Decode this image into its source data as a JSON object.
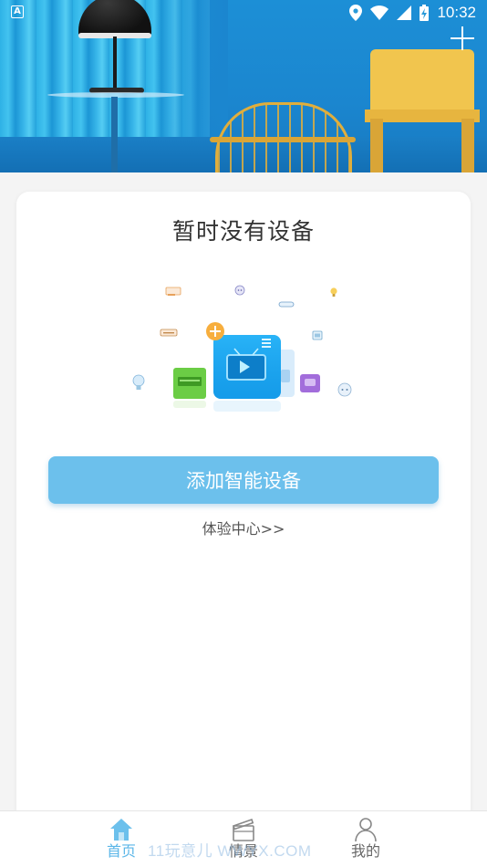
{
  "status_bar": {
    "app_indicator": "A",
    "time": "10:32",
    "icons": [
      "location-icon",
      "wifi-icon",
      "signal-icon",
      "battery-charging-icon"
    ]
  },
  "header": {
    "add_icon": "plus-icon"
  },
  "empty_state": {
    "title": "暂时没有设备",
    "add_device_label": "添加智能设备",
    "experience_link": "体验中心>>"
  },
  "bottom_nav": {
    "items": [
      {
        "label": "首页",
        "icon": "home-icon",
        "active": true
      },
      {
        "label": "情景",
        "icon": "clapperboard-icon",
        "active": false
      },
      {
        "label": "我的",
        "icon": "profile-icon",
        "active": false
      }
    ]
  },
  "watermark": "11玩意儿 WWYX.COM",
  "colors": {
    "accent": "#6cc0ec",
    "active_nav": "#5bb6e8",
    "banner": "#1b86cf"
  }
}
